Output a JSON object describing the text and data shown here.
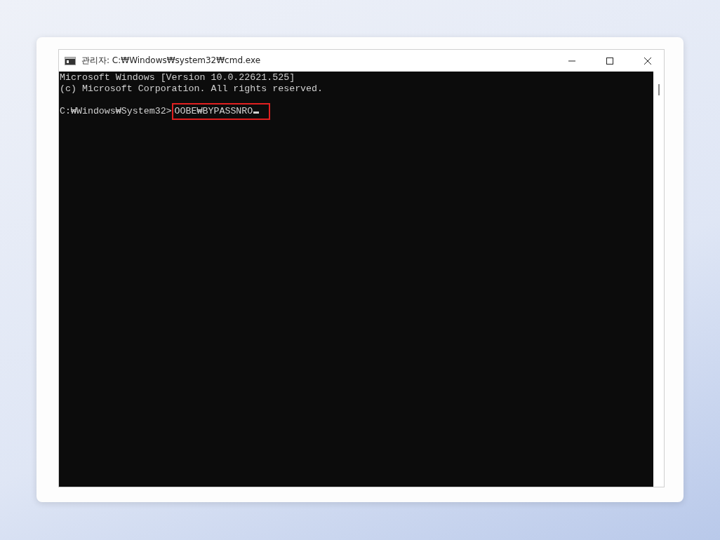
{
  "window": {
    "title": "관리자: C:₩Windows₩system32₩cmd.exe"
  },
  "console": {
    "lines": [
      "Microsoft Windows [Version 10.0.22621.525]",
      "(c) Microsoft Corporation. All rights reserved."
    ],
    "prompt": "C:₩Windows₩System32>",
    "command": {
      "text": "OOBE₩BYPASSNRO",
      "highlighted": true
    }
  }
}
